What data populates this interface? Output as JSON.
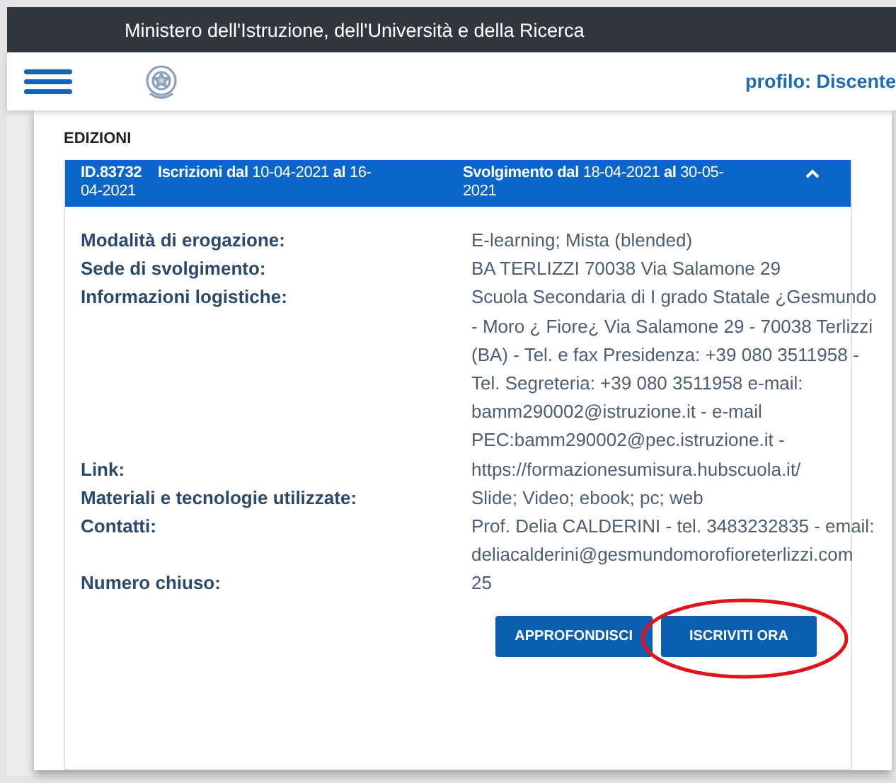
{
  "top_bar": {
    "title": "Ministero dell'Istruzione, dell'Università e della Ricerca"
  },
  "header": {
    "profile": "profilo: Discente"
  },
  "section": {
    "title": "EDIZIONI"
  },
  "edition": {
    "id": "ID.83732",
    "enrollment": "**Iscrizioni dal** 10-04-2021 **al** 16-04-2021",
    "period": "**Svolgimento dal** 18-04-2021 **al** 30-05-2021",
    "expanded": true,
    "details": [
      {
        "label": "Modalità di erogazione:",
        "value": "E-learning; Mista (blended)"
      },
      {
        "label": "Sede di svolgimento:",
        "value": "BA TERLIZZI 70038 Via Salamone 29"
      },
      {
        "label": "Informazioni logistiche:",
        "value": "Scuola Secondaria di I grado Statale ¿Gesmundo - Moro ¿ Fiore¿ Via Salamone 29 - 70038 Terlizzi (BA) - Tel. e fax Presidenza: +39 080 3511958 - Tel. Segreteria: +39 080 3511958 e-mail: bamm290002@istruzione.it - e-mail PEC:bamm290002@pec.istruzione.it -"
      },
      {
        "label": "Link:",
        "value": "https://formazionesumisura.hubscuola.it/"
      },
      {
        "label": "Materiali e tecnologie utilizzate:",
        "value": "Slide; Video; ebook; pc; web"
      },
      {
        "label": "Contatti:",
        "value": "Prof. Delia CALDERINI - tel. 3483232835 - email: deliacalderini@gesmundomorofioreterlizzi.com"
      },
      {
        "label": "Numero chiuso:",
        "value": "25"
      }
    ],
    "buttons": [
      {
        "label": "APPROFONDISCI",
        "highlighted": false
      },
      {
        "label": "ISCRIVITI ORA",
        "highlighted": true
      }
    ]
  }
}
